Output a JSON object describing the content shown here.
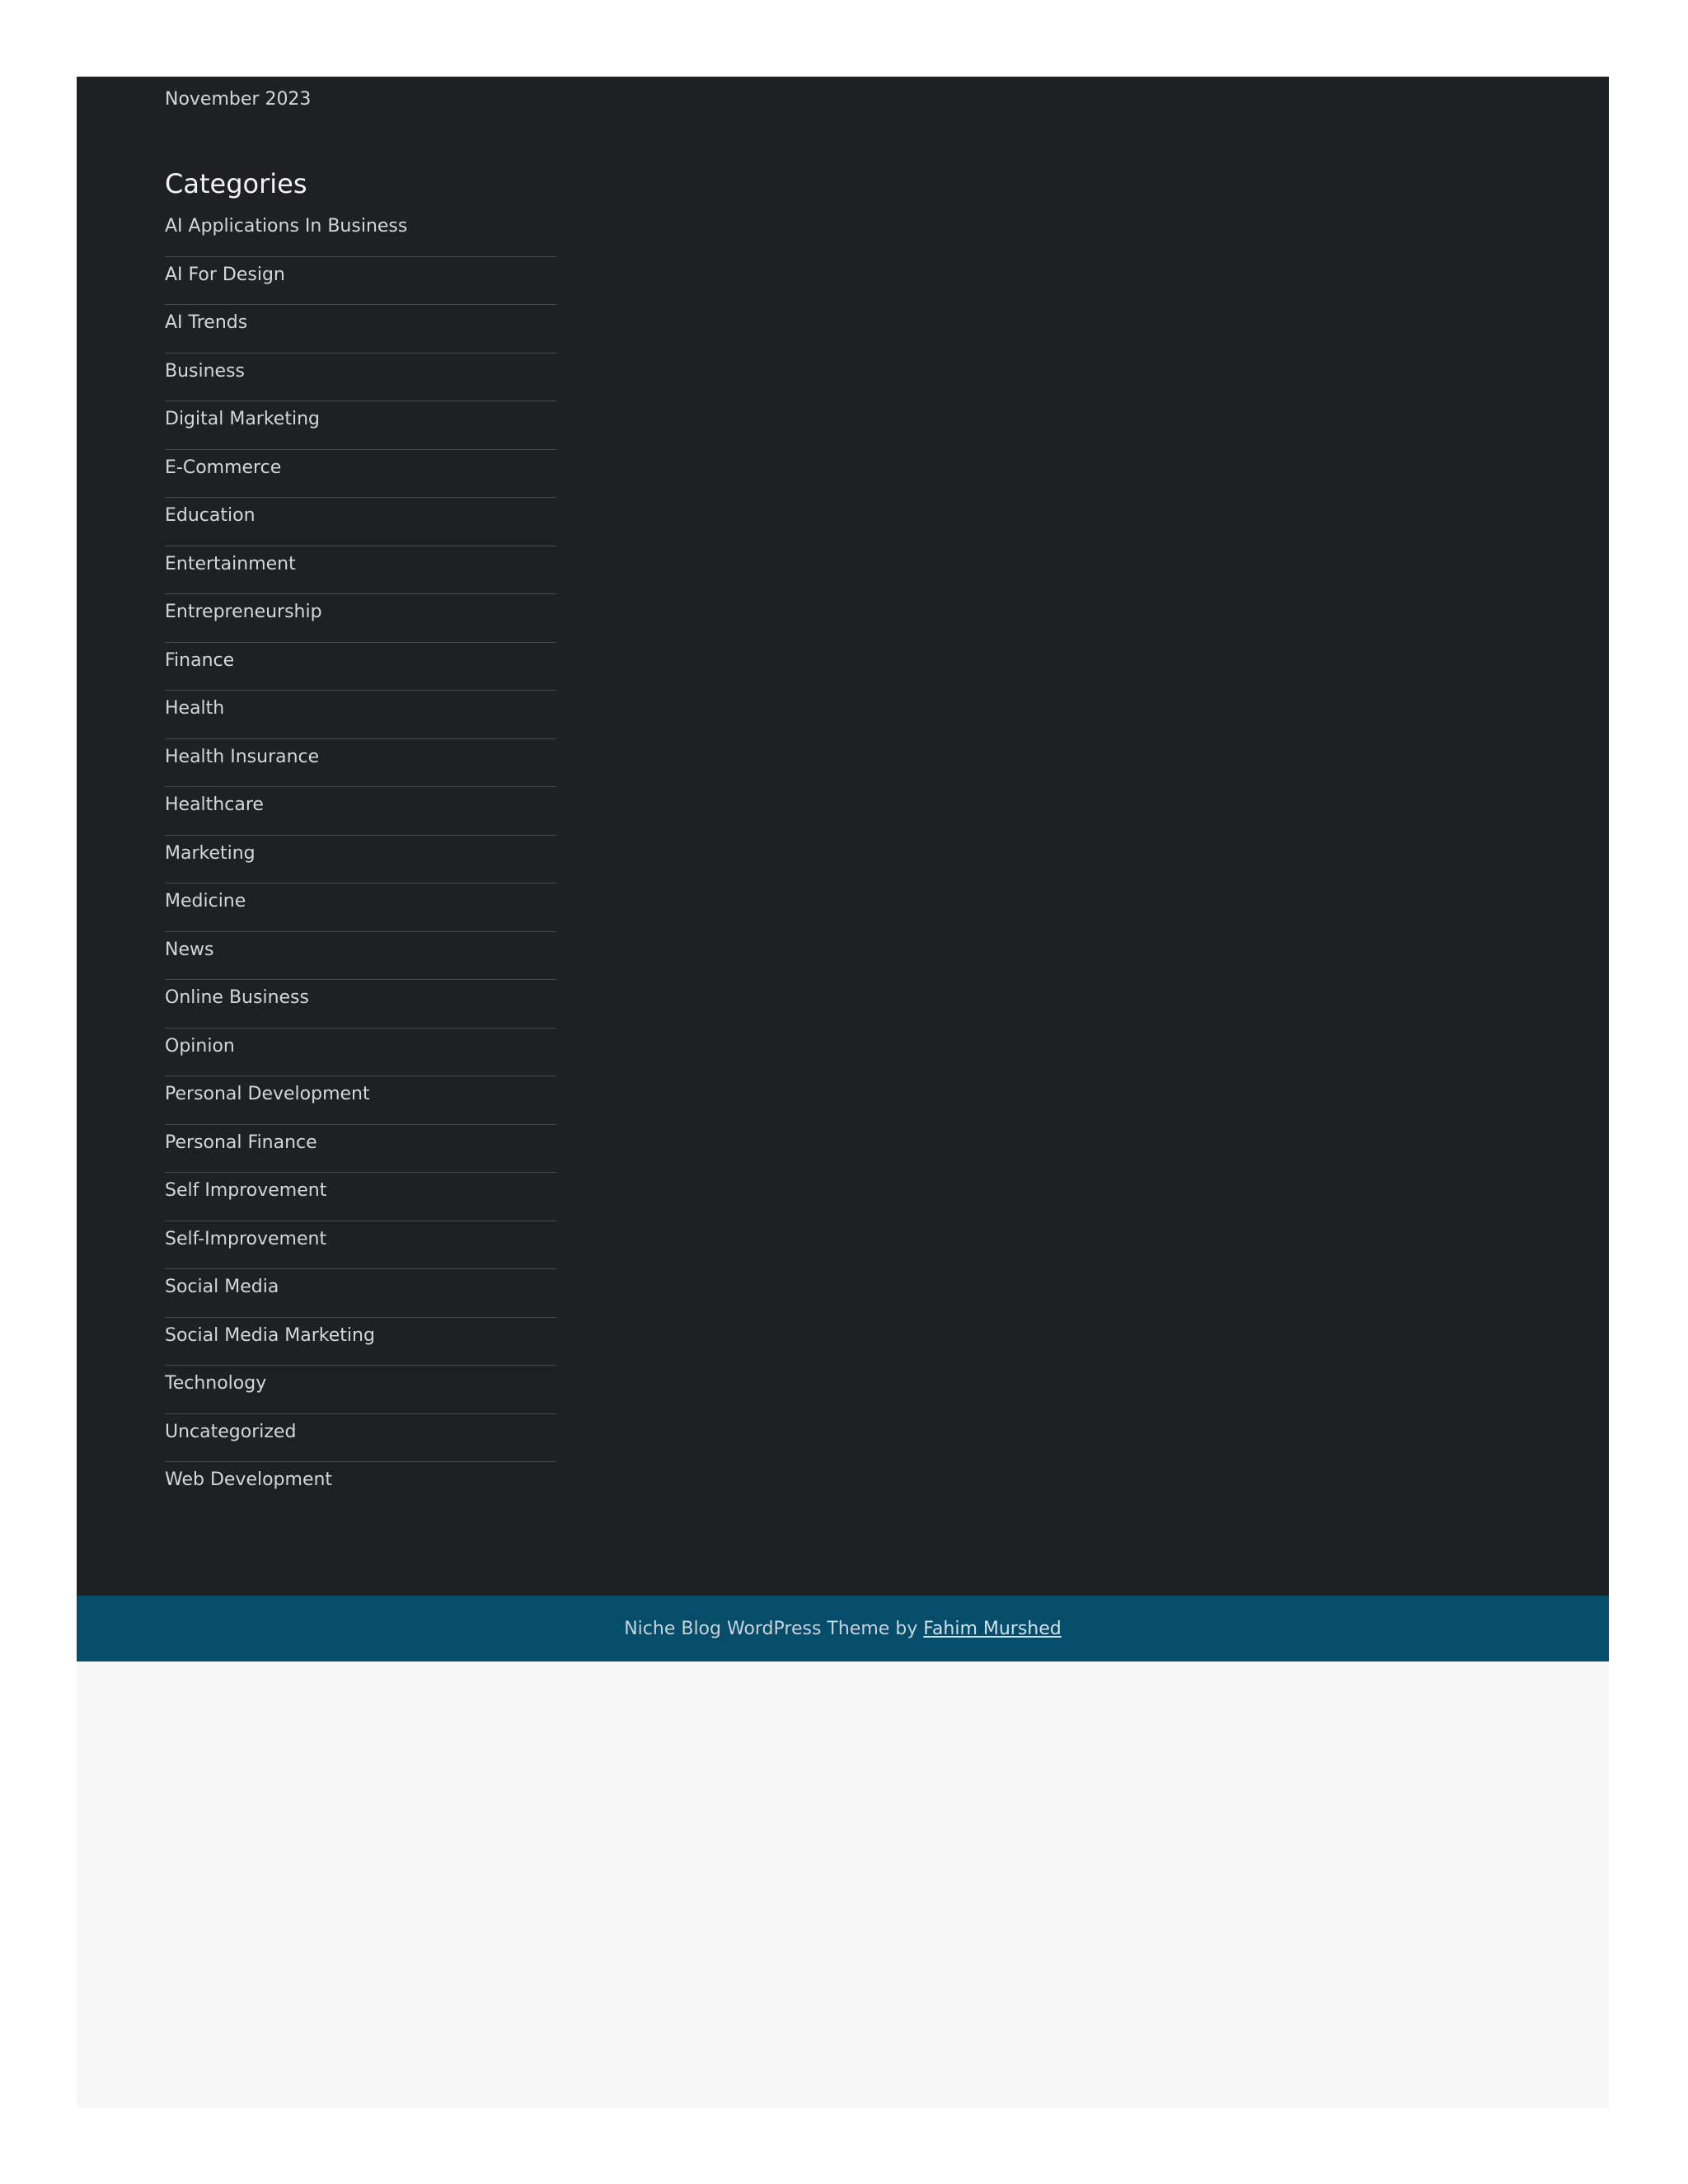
{
  "archives": {
    "items": [
      "November 2023"
    ]
  },
  "categories": {
    "title": "Categories",
    "items": [
      "AI Applications In Business",
      "AI For Design",
      "AI Trends",
      "Business",
      "Digital Marketing",
      "E-Commerce",
      "Education",
      "Entertainment",
      "Entrepreneurship",
      "Finance",
      "Health",
      "Health Insurance",
      "Healthcare",
      "Marketing",
      "Medicine",
      "News",
      "Online Business",
      "Opinion",
      "Personal Development",
      "Personal Finance",
      "Self Improvement",
      "Self-Improvement",
      "Social Media",
      "Social Media Marketing",
      "Technology",
      "Uncategorized",
      "Web Development"
    ]
  },
  "footer": {
    "credit_text": "Niche Blog WordPress Theme by ",
    "author_link": "Fahim Murshed"
  },
  "colors": {
    "widget_background": "#1e2023",
    "footer_bar": "#064d6c",
    "page_background": "#f7f7f7"
  }
}
